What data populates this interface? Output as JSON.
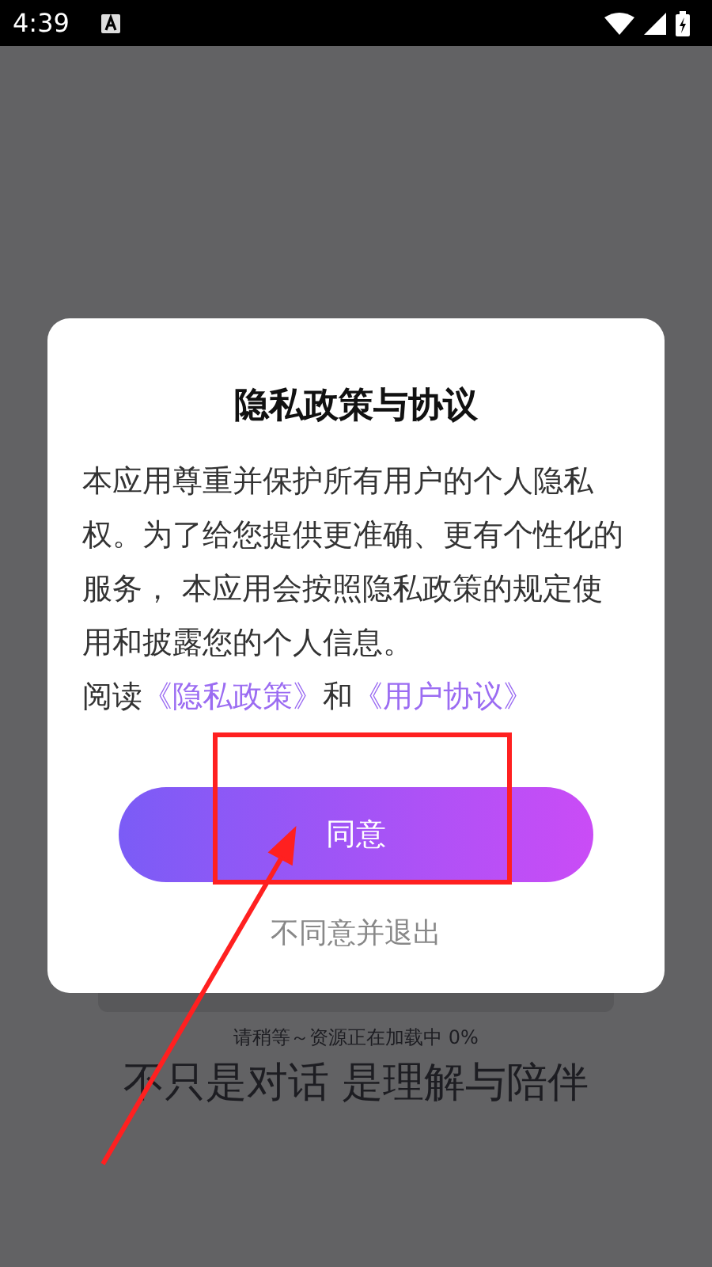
{
  "status_bar": {
    "time": "4:39"
  },
  "dialog": {
    "title": "隐私政策与协议",
    "body": "本应用尊重并保护所有用户的个人隐私权。为了给您提供更准确、更有个性化的服务， 本应用会按照隐私政策的规定使用和披露您的个人信息。",
    "read_prefix": "阅读",
    "links": [
      {
        "label": "《隐私政策》"
      },
      {
        "label": "《用户协议》"
      }
    ],
    "conjunction": "和",
    "agree_button": "同意",
    "decline_button": "不同意并退出"
  },
  "background": {
    "loading_text": "请稍等～资源正在加载中 0%",
    "tagline": "不只是对话 是理解与陪伴"
  }
}
